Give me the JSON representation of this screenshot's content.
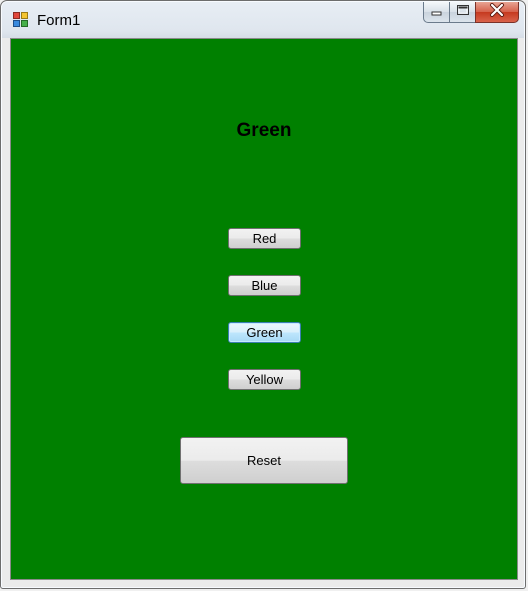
{
  "window": {
    "title": "Form1",
    "icon": "windows-forms-app-icon",
    "caption_buttons": [
      "minimize-icon",
      "maximize-icon",
      "close-icon"
    ]
  },
  "form": {
    "background_color": "#008000",
    "label": "Green",
    "buttons": {
      "red": "Red",
      "blue": "Blue",
      "green": "Green",
      "yellow": "Yellow",
      "reset": "Reset"
    },
    "focused_button": "Green"
  }
}
